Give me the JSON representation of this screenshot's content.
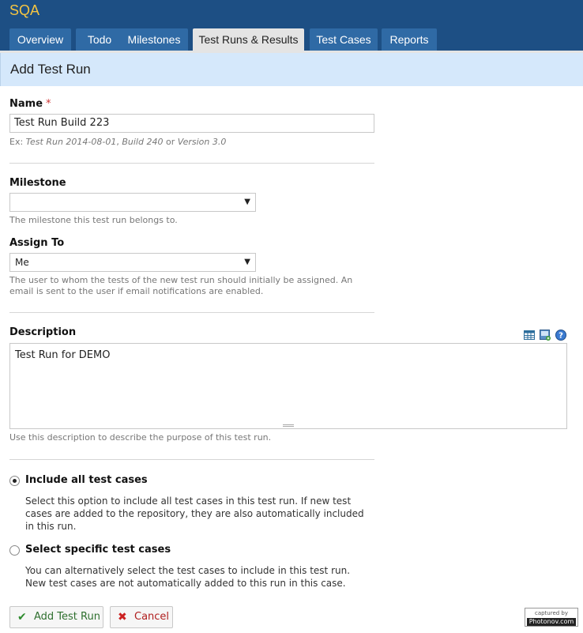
{
  "app": {
    "title": "SQA"
  },
  "tabs": [
    {
      "label": "Overview",
      "active": false
    },
    {
      "label": "Todo",
      "active": false
    },
    {
      "label": "Milestones",
      "active": false
    },
    {
      "label": "Test Runs & Results",
      "active": true
    },
    {
      "label": "Test Cases",
      "active": false
    },
    {
      "label": "Reports",
      "active": false
    }
  ],
  "panel": {
    "title": "Add Test Run"
  },
  "form": {
    "name": {
      "label": "Name",
      "required_mark": "*",
      "value": "Test Run Build 223",
      "hint_prefix": "Ex: ",
      "hint_ex1": "Test Run 2014-08-01",
      "hint_sep1": ", ",
      "hint_ex2": "Build 240",
      "hint_sep2": " or ",
      "hint_ex3": "Version 3.0"
    },
    "milestone": {
      "label": "Milestone",
      "selected": "",
      "hint": "The milestone this test run belongs to."
    },
    "assign_to": {
      "label": "Assign To",
      "selected": "Me",
      "hint": "The user to whom the tests of the new test run should initially be assigned. An email is sent to the user if email notifications are enabled."
    },
    "description": {
      "label": "Description",
      "value": "Test Run for DEMO",
      "hint": "Use this description to describe the purpose of this test run.",
      "toolbar_icons": [
        "table-icon",
        "image-icon",
        "help-icon"
      ]
    },
    "options": [
      {
        "title": "Include all test cases",
        "checked": true,
        "text": "Select this option to include all test cases in this test run. If new test cases are added to the repository, they are also automatically included in this run."
      },
      {
        "title": "Select specific test cases",
        "checked": false,
        "text": "You can alternatively select the test cases to include in this test run. New test cases are not automatically added to this run in this case."
      }
    ]
  },
  "actions": {
    "submit_label": "Add Test Run",
    "cancel_label": "Cancel",
    "submit_icon": "checkmark-icon",
    "cancel_icon": "x-icon",
    "colors": {
      "submit": "#2e8b2e",
      "cancel": "#cc2222"
    }
  },
  "badge": {
    "line1": "captured by",
    "line2": "Photonov.com"
  }
}
